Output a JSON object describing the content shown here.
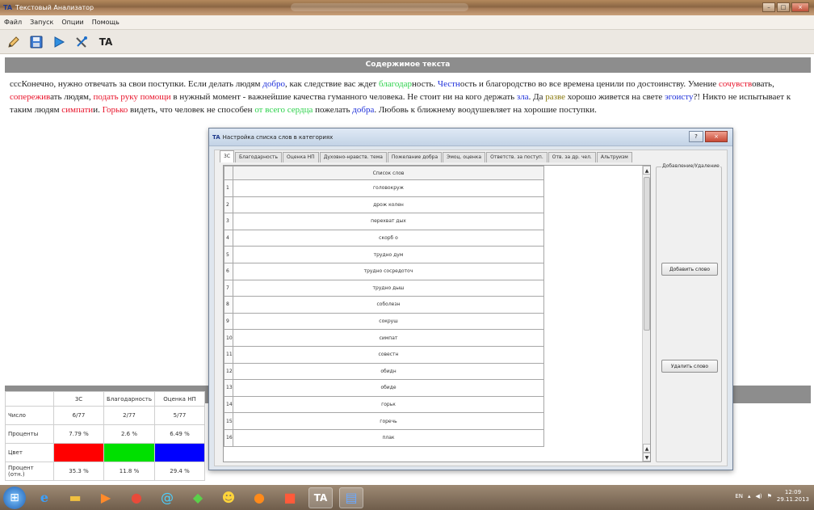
{
  "window": {
    "app_icon": "TA",
    "title": "Текстовый Анализатор"
  },
  "menu": [
    "Файл",
    "Запуск",
    "Опции",
    "Помощь"
  ],
  "toolbar": {
    "ta_label": "TA"
  },
  "content_header": "Содержимое текста",
  "text_segments": [
    {
      "t": "сссКонечно, нужно отвечать за свои поступки. Если делать людям ",
      "c": ""
    },
    {
      "t": "добро",
      "c": "blue"
    },
    {
      "t": ", как следствие вас ждет ",
      "c": ""
    },
    {
      "t": "благодар",
      "c": "green"
    },
    {
      "t": "ность. ",
      "c": ""
    },
    {
      "t": "Честн",
      "c": "blue"
    },
    {
      "t": "ость и благородство во все времена ценили по достоинству. Умение ",
      "c": ""
    },
    {
      "t": "сочувств",
      "c": "red"
    },
    {
      "t": "овать, ",
      "c": ""
    },
    {
      "t": "сопережив",
      "c": "red"
    },
    {
      "t": "ать людям, ",
      "c": ""
    },
    {
      "t": "подать руку помощи",
      "c": "red"
    },
    {
      "t": " в нужный момент - важнейшие качества гуманного человека. Не стоит ни на кого держать ",
      "c": ""
    },
    {
      "t": "зла",
      "c": "blue"
    },
    {
      "t": ". Да ",
      "c": ""
    },
    {
      "t": "разве",
      "c": "olive"
    },
    {
      "t": " хорошо живется на свете ",
      "c": ""
    },
    {
      "t": "эгоисту",
      "c": "blue"
    },
    {
      "t": "?! Никто не испытывает к таким людям ",
      "c": ""
    },
    {
      "t": "симпати",
      "c": "red"
    },
    {
      "t": "и. ",
      "c": ""
    },
    {
      "t": "Горько",
      "c": "red"
    },
    {
      "t": " видеть, что человек не способен ",
      "c": ""
    },
    {
      "t": "от всего сердца",
      "c": "green"
    },
    {
      "t": " пожелать ",
      "c": ""
    },
    {
      "t": "добра",
      "c": "blue"
    },
    {
      "t": ". Любовь к ближнему воодушевляет на хорошие поступки.",
      "c": ""
    }
  ],
  "colors": {
    "red": "#e8132a",
    "green": "#2bd14a",
    "blue": "#1d2fd9",
    "olive": "#8a7a10"
  },
  "stats": {
    "columns": [
      "3С",
      "Благодарность",
      "Оценка НП"
    ],
    "rows": [
      {
        "label": "Число",
        "values": [
          "6/77",
          "2/77",
          "5/77"
        ]
      },
      {
        "label": "Проценты",
        "values": [
          "7.79 %",
          "2.6 %",
          "6.49 %"
        ]
      },
      {
        "label": "Цвет",
        "swatches": [
          "#ff0000",
          "#00e000",
          "#0000ff"
        ]
      },
      {
        "label": "Процент (отн.)",
        "values": [
          "35.3 %",
          "11.8 %",
          "29.4 %"
        ]
      }
    ]
  },
  "dialog": {
    "app_icon": "TA",
    "title": "Настройка списка слов в категориях",
    "tabs": [
      "3С",
      "Благодарность",
      "Оценка НП",
      "Духовно-нравств. тема",
      "Пожелание добра",
      "Эмоц. оценка",
      "Ответств. за поступ.",
      "Отв. за др. чел.",
      "Альтруизм"
    ],
    "active_tab": 0,
    "column_header": "Список слов",
    "words": [
      "головокруж",
      "дрож колен",
      "перехват дых",
      "скорб  о",
      "трудно дум",
      "трудно сосредоточ",
      "трудно дыш",
      "соболезн",
      "сокруш",
      "симпат",
      "совестн",
      "обидн",
      "обиде",
      "горьк",
      "горечь",
      "плак"
    ],
    "group_label": "Добавление/Удаление",
    "add_button": "Добавить слово",
    "remove_button": "Удалить слово"
  },
  "taskbar": {
    "active_label": "TA",
    "lang": "EN",
    "time": "12:09",
    "date": "29.11.2013"
  }
}
